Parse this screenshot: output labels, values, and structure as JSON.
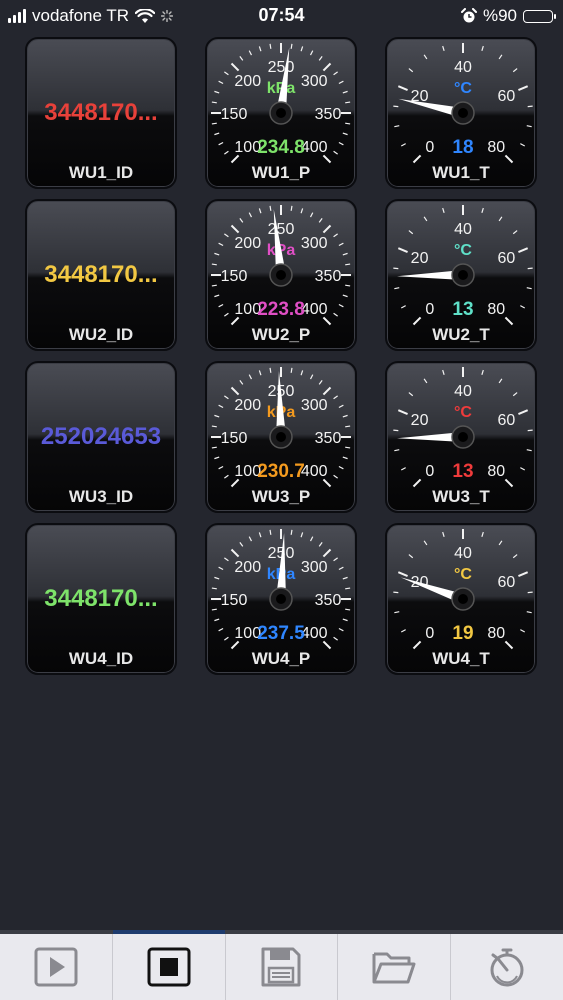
{
  "status_bar": {
    "carrier": "vodafone TR",
    "time": "07:54",
    "battery_label": "%90",
    "battery_level": 0.9,
    "icons": [
      "signal-icon",
      "wifi-icon",
      "activity-icon",
      "alarm-icon",
      "battery-icon"
    ]
  },
  "rows": [
    {
      "id_tile": {
        "value": "3448170...",
        "label": "WU1_ID",
        "color": "#e8413a"
      },
      "pressure": {
        "label": "WU1_P",
        "unit": "kPa",
        "value": 234.8,
        "value_text": "234.8",
        "color": "#7ee36a",
        "ticks": [
          "100",
          "150",
          "200",
          "250",
          "300",
          "350",
          "400"
        ],
        "needle_value": 258
      },
      "temp": {
        "label": "WU1_T",
        "unit": "°C",
        "value": 18,
        "value_text": "18",
        "color": "#2f86ff",
        "ticks": [
          "0",
          "20",
          "40",
          "60",
          "80"
        ],
        "needle_value": 17
      }
    },
    {
      "id_tile": {
        "value": "3448170...",
        "label": "WU2_ID",
        "color": "#f2c843"
      },
      "pressure": {
        "label": "WU2_P",
        "unit": "kPa",
        "value": 223.8,
        "value_text": "223.8",
        "color": "#e04fc5",
        "ticks": [
          "100",
          "150",
          "200",
          "250",
          "300",
          "350",
          "400"
        ],
        "needle_value": 243
      },
      "temp": {
        "label": "WU2_T",
        "unit": "°C",
        "value": 13,
        "value_text": "13",
        "color": "#5fe0c8",
        "ticks": [
          "0",
          "20",
          "40",
          "60",
          "80"
        ],
        "needle_value": 13
      }
    },
    {
      "id_tile": {
        "value": "252024653",
        "label": "WU3_ID",
        "color": "#5a5ad8"
      },
      "pressure": {
        "label": "WU3_P",
        "unit": "kPa",
        "value": 230.7,
        "value_text": "230.7",
        "color": "#f39a1f",
        "ticks": [
          "100",
          "150",
          "200",
          "250",
          "300",
          "350",
          "400"
        ],
        "needle_value": 248
      },
      "temp": {
        "label": "WU3_T",
        "unit": "°C",
        "value": 13,
        "value_text": "13",
        "color": "#ef3b3b",
        "ticks": [
          "0",
          "20",
          "40",
          "60",
          "80"
        ],
        "needle_value": 13
      }
    },
    {
      "id_tile": {
        "value": "3448170...",
        "label": "WU4_ID",
        "color": "#7ee36a"
      },
      "pressure": {
        "label": "WU4_P",
        "unit": "kPa",
        "value": 237.5,
        "value_text": "237.5",
        "color": "#2f86ff",
        "ticks": [
          "100",
          "150",
          "200",
          "250",
          "300",
          "350",
          "400"
        ],
        "needle_value": 253
      },
      "temp": {
        "label": "WU4_T",
        "unit": "°C",
        "value": 19,
        "value_text": "19",
        "color": "#f2c843",
        "ticks": [
          "0",
          "20",
          "40",
          "60",
          "80"
        ],
        "needle_value": 19
      }
    }
  ],
  "toolbar": {
    "buttons": [
      {
        "name": "play-button",
        "icon": "play-icon",
        "active": false
      },
      {
        "name": "stop-button",
        "icon": "stop-icon",
        "active": true
      },
      {
        "name": "save-button",
        "icon": "floppy-disk-icon",
        "active": false
      },
      {
        "name": "open-folder-button",
        "icon": "folder-icon",
        "active": false
      },
      {
        "name": "gauge-settings-button",
        "icon": "stopwatch-gauge-icon",
        "active": false
      }
    ]
  }
}
